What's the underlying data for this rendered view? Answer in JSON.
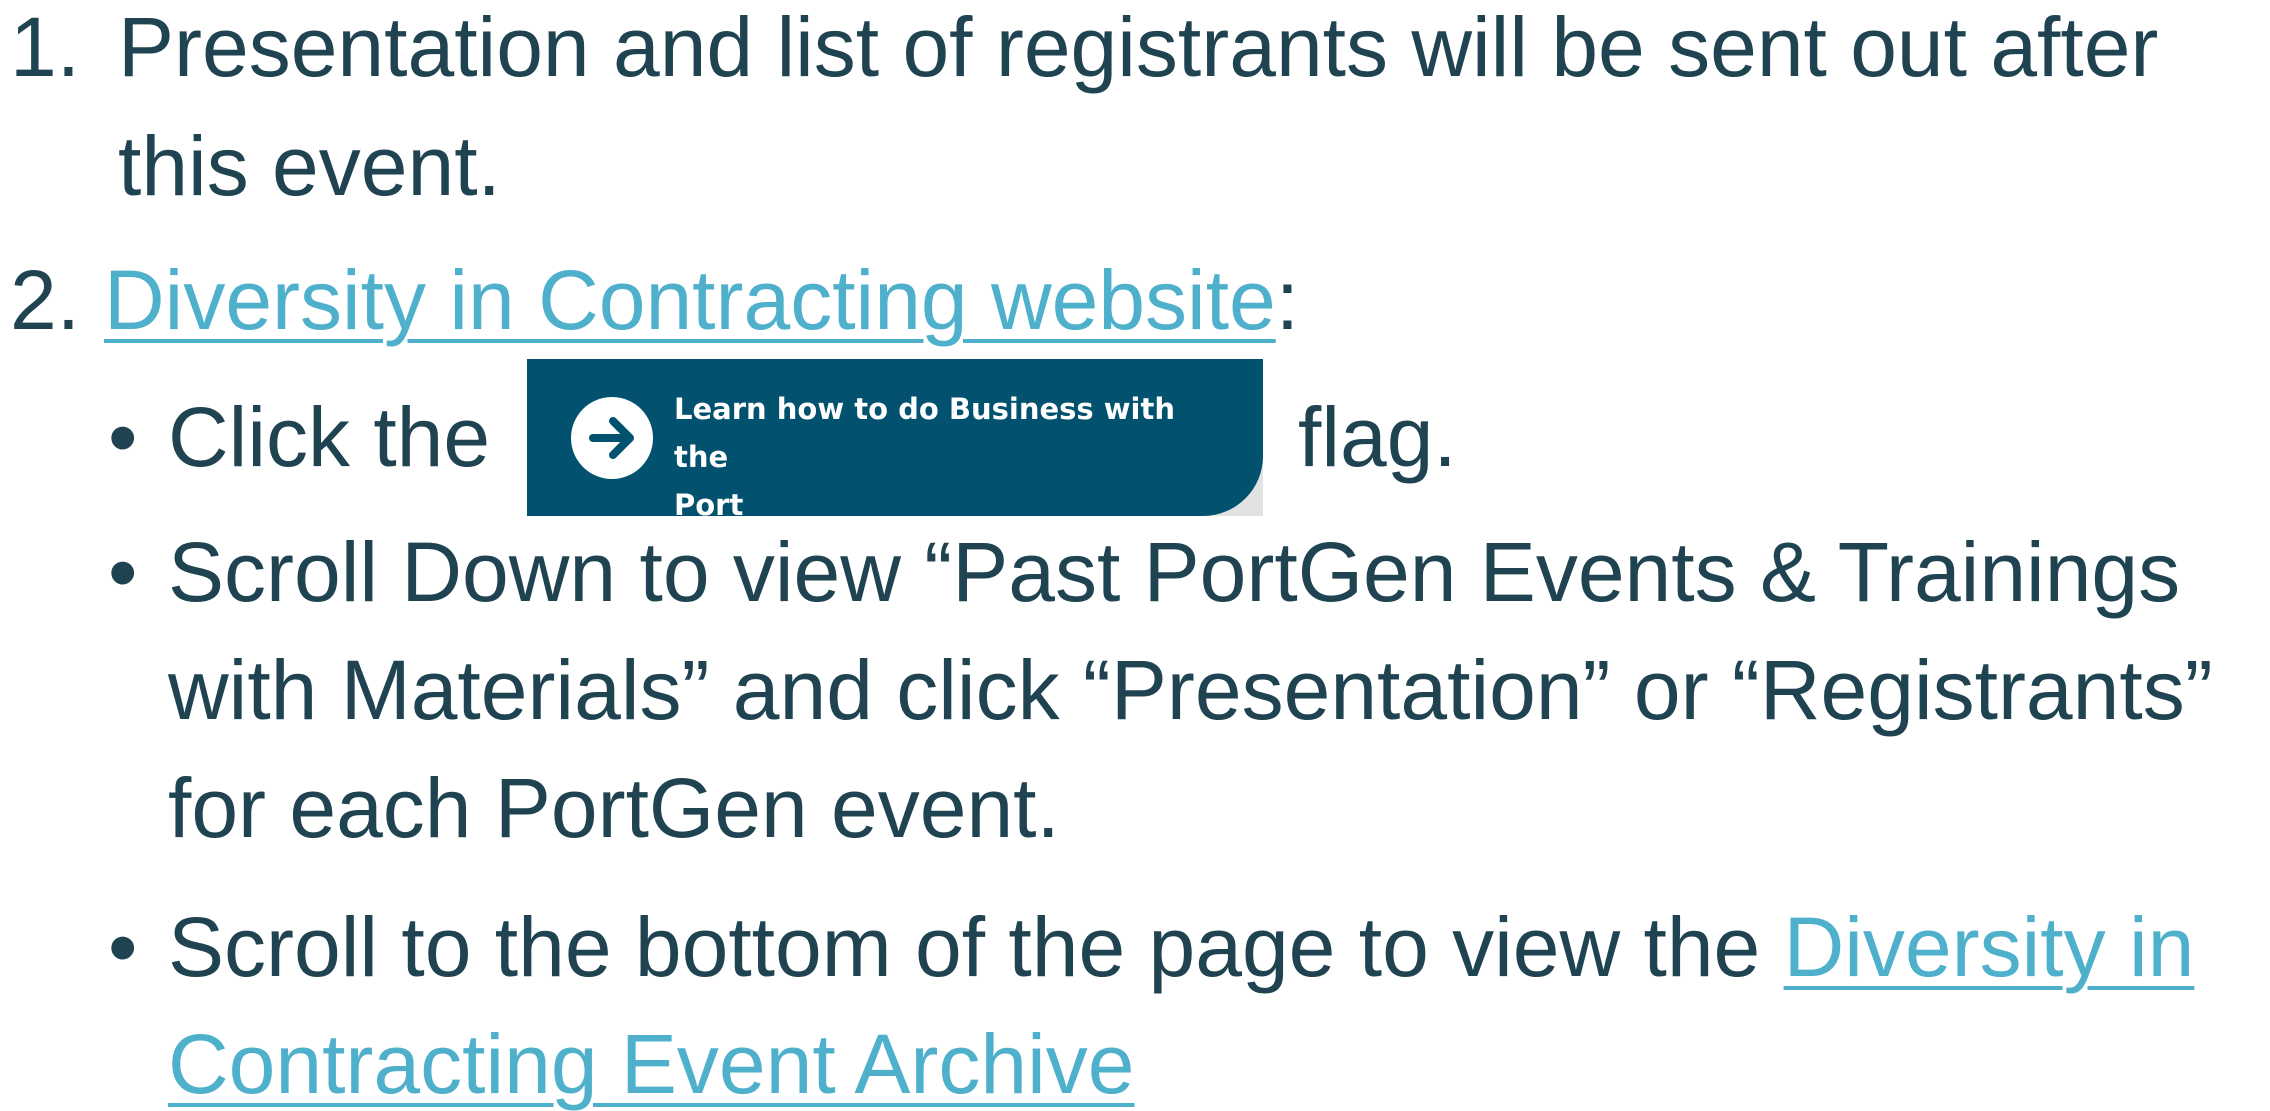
{
  "item1": {
    "number": "1.",
    "line1": "Presentation and list of registrants will be sent out after",
    "line2": "this event."
  },
  "item2": {
    "number": "2.",
    "link_text": "Diversity in Contracting website",
    "after_link": ":",
    "bullet_char": "•",
    "bullet1": {
      "before": "Click the",
      "after": "flag.",
      "flag_label_line1": "Learn how to do Business with the",
      "flag_label_line2": "Port",
      "flag_icon": "arrow-right-circle-icon"
    },
    "bullet2": {
      "line1": "Scroll Down to view “Past PortGen Events & Trainings",
      "line2": "with Materials” and click “Presentation” or “Registrants”",
      "line3": "for each PortGen event."
    },
    "bullet3": {
      "line1_text": "Scroll to the bottom of the page to view the ",
      "line1_link": "Diversity in",
      "line2_link": "Contracting Event Archive"
    }
  },
  "colors": {
    "text": "#1f4350",
    "link": "#4fb0cc",
    "flag_background": "#02526f",
    "flag_text": "#ffffff"
  }
}
